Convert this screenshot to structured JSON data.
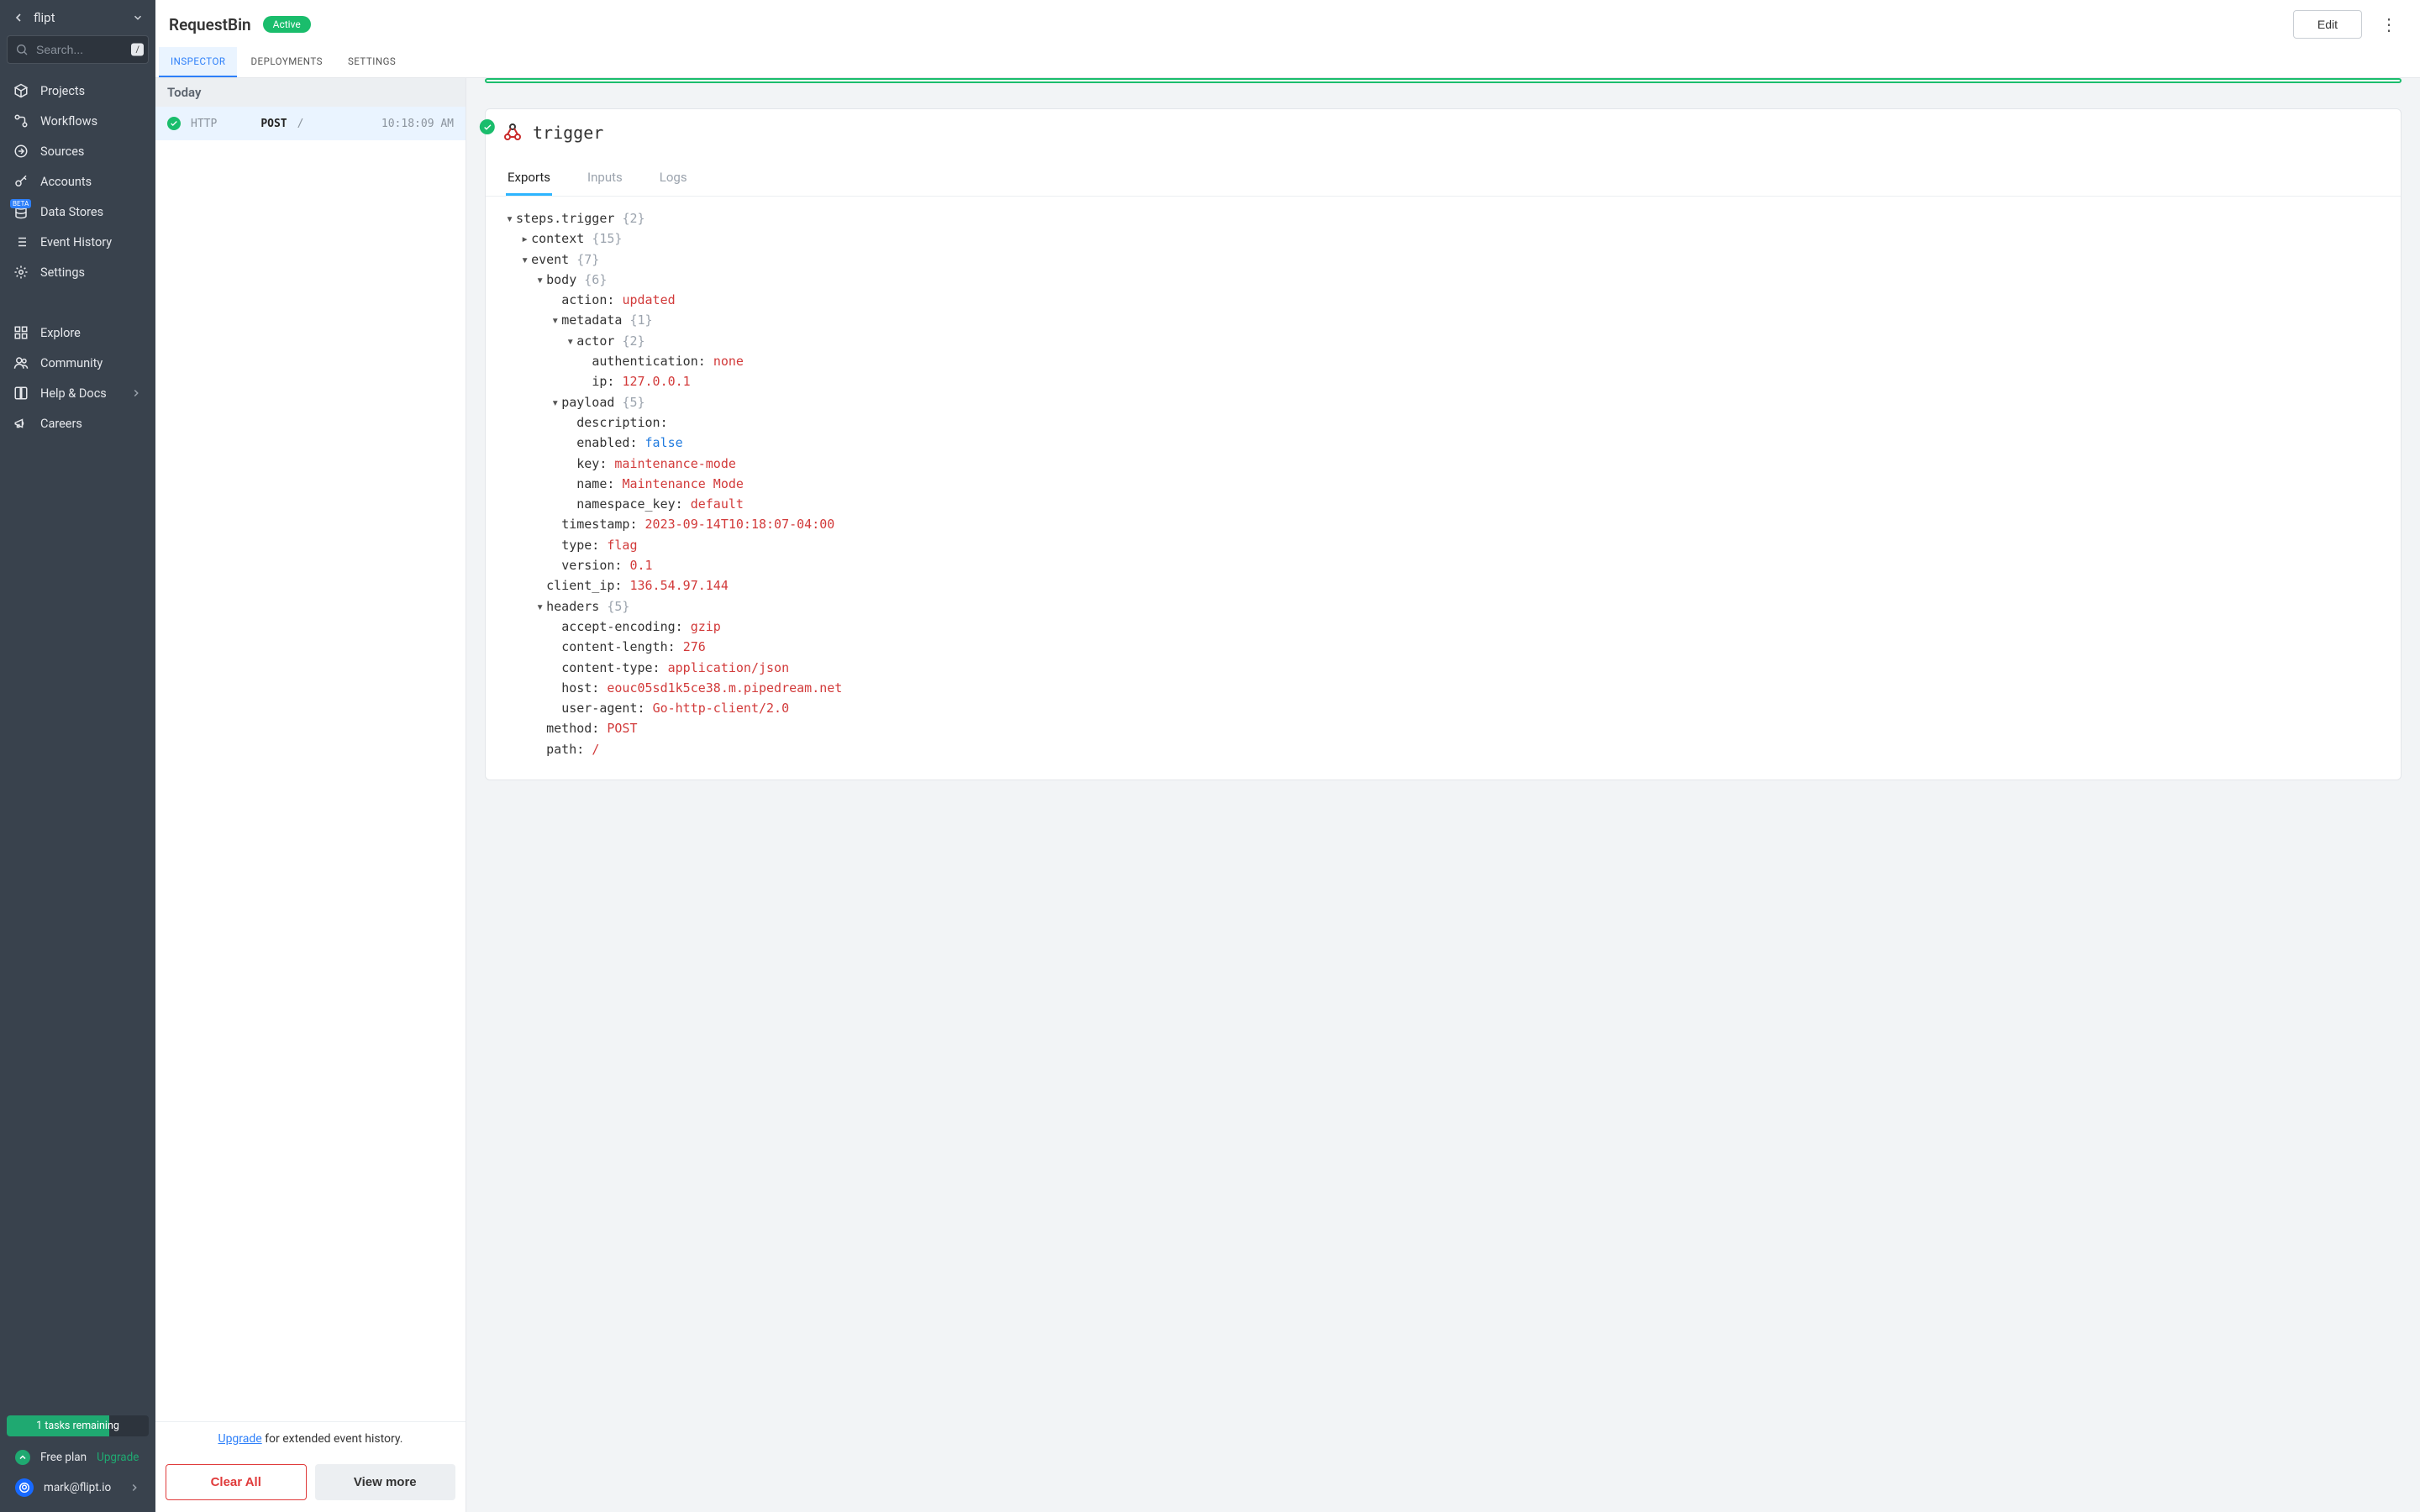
{
  "sidebar": {
    "workspace": "flipt",
    "search_placeholder": "Search...",
    "search_kbd": "/",
    "nav_primary": [
      {
        "label": "Projects",
        "icon": "cube"
      },
      {
        "label": "Workflows",
        "icon": "flow"
      },
      {
        "label": "Sources",
        "icon": "arrow-out"
      },
      {
        "label": "Accounts",
        "icon": "key"
      },
      {
        "label": "Data Stores",
        "icon": "db",
        "beta": "BETA"
      },
      {
        "label": "Event History",
        "icon": "list"
      },
      {
        "label": "Settings",
        "icon": "gear"
      }
    ],
    "nav_secondary": [
      {
        "label": "Explore",
        "icon": "grid"
      },
      {
        "label": "Community",
        "icon": "people"
      },
      {
        "label": "Help & Docs",
        "icon": "book",
        "chevron": true
      },
      {
        "label": "Careers",
        "icon": "megaphone"
      }
    ],
    "tasks_text": "1 tasks remaining",
    "plan_label": "Free plan",
    "upgrade_label": "Upgrade",
    "user_email": "mark@flipt.io"
  },
  "header": {
    "title": "RequestBin",
    "status": "Active",
    "edit_label": "Edit",
    "tabs": [
      "INSPECTOR",
      "DEPLOYMENTS",
      "SETTINGS"
    ],
    "active_tab": 0
  },
  "events": {
    "group_header": "Today",
    "rows": [
      {
        "proto": "HTTP",
        "method": "POST",
        "path": "/",
        "timestamp": "10:18:09 AM"
      }
    ],
    "footer_upgrade": "Upgrade",
    "footer_rest": " for extended event history.",
    "clear_label": "Clear All",
    "more_label": "View more"
  },
  "detail": {
    "trigger_title": "trigger",
    "tabs": [
      "Exports",
      "Inputs",
      "Logs"
    ],
    "tree": [
      {
        "indent": 0,
        "caret": "open",
        "key": "steps.trigger",
        "meta": "{2}"
      },
      {
        "indent": 1,
        "caret": "closed",
        "key": "context",
        "meta": "{15}"
      },
      {
        "indent": 1,
        "caret": "open",
        "key": "event",
        "meta": "{7}"
      },
      {
        "indent": 2,
        "caret": "open",
        "key": "body",
        "meta": "{6}"
      },
      {
        "indent": 3,
        "key": "action:",
        "val": "updated",
        "vt": "str"
      },
      {
        "indent": 3,
        "caret": "open",
        "key": "metadata",
        "meta": "{1}"
      },
      {
        "indent": 4,
        "caret": "open",
        "key": "actor",
        "meta": "{2}"
      },
      {
        "indent": 5,
        "key": "authentication:",
        "val": "none",
        "vt": "str"
      },
      {
        "indent": 5,
        "key": "ip:",
        "val": "127.0.0.1",
        "vt": "str"
      },
      {
        "indent": 3,
        "caret": "open",
        "key": "payload",
        "meta": "{5}"
      },
      {
        "indent": 4,
        "key": "description:",
        "val": "",
        "vt": "none"
      },
      {
        "indent": 4,
        "key": "enabled:",
        "val": "false",
        "vt": "bool"
      },
      {
        "indent": 4,
        "key": "key:",
        "val": "maintenance-mode",
        "vt": "str"
      },
      {
        "indent": 4,
        "key": "name:",
        "val": "Maintenance Mode",
        "vt": "str"
      },
      {
        "indent": 4,
        "key": "namespace_key:",
        "val": "default",
        "vt": "str"
      },
      {
        "indent": 3,
        "key": "timestamp:",
        "val": "2023-09-14T10:18:07-04:00",
        "vt": "str"
      },
      {
        "indent": 3,
        "key": "type:",
        "val": "flag",
        "vt": "str"
      },
      {
        "indent": 3,
        "key": "version:",
        "val": "0.1",
        "vt": "str"
      },
      {
        "indent": 2,
        "key": "client_ip:",
        "val": "136.54.97.144",
        "vt": "str"
      },
      {
        "indent": 2,
        "caret": "open",
        "key": "headers",
        "meta": "{5}"
      },
      {
        "indent": 3,
        "key": "accept-encoding:",
        "val": "gzip",
        "vt": "str"
      },
      {
        "indent": 3,
        "key": "content-length:",
        "val": "276",
        "vt": "str"
      },
      {
        "indent": 3,
        "key": "content-type:",
        "val": "application/json",
        "vt": "str"
      },
      {
        "indent": 3,
        "key": "host:",
        "val": "eouc05sd1k5ce38.m.pipedream.net",
        "vt": "str"
      },
      {
        "indent": 3,
        "key": "user-agent:",
        "val": "Go-http-client/2.0",
        "vt": "str"
      },
      {
        "indent": 2,
        "key": "method:",
        "val": "POST",
        "vt": "str"
      },
      {
        "indent": 2,
        "key": "path:",
        "val": "/",
        "vt": "str"
      }
    ]
  }
}
